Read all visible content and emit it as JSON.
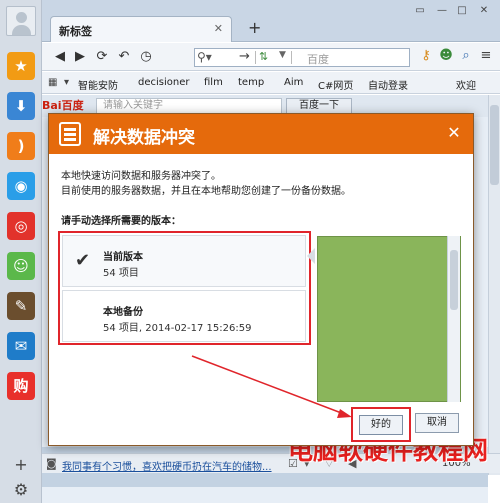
{
  "browser": {
    "tab": {
      "title": "新标签",
      "close": "✕"
    },
    "new_tab": "+",
    "search_placeholder": "百度",
    "bookmarks": [
      "智能安防",
      "decisioner",
      "film",
      "temp",
      "Aim",
      "C#网页",
      "自动登录",
      "欢迎"
    ],
    "winbtns": {
      "minimize": "▭",
      "restore": "—",
      "maximize": "□",
      "close": "✕"
    }
  },
  "page": {
    "logo": "Bai百度",
    "search_placeholder": "请输入关键字",
    "search_button": "百度一下"
  },
  "status": {
    "text": "我同事有个习惯，喜欢把硬币扔在汽车的储物...",
    "zoom": "100%"
  },
  "watermark": "电脑软硬件教程网",
  "dialog": {
    "title": "解决数据冲突",
    "close": "✕",
    "desc_line1": "本地快速访问数据和服务器冲突了。",
    "desc_line2": "目前使用的服务器数据，并且在本地帮助您创建了一份备份数据。",
    "prompt": "请手动选择所需要的版本：",
    "versions": [
      {
        "name": "当前版本",
        "sub": "54 项目"
      },
      {
        "name": "本地备份",
        "sub": "54 项目, 2014-02-17 15:26:59"
      }
    ],
    "ok_label": "好的",
    "cancel_label": "取消"
  },
  "colors": {
    "header": "#e56a0c",
    "highlight": "#e0252b",
    "preview": "#8ab55b",
    "watermark": "#e8201e"
  }
}
